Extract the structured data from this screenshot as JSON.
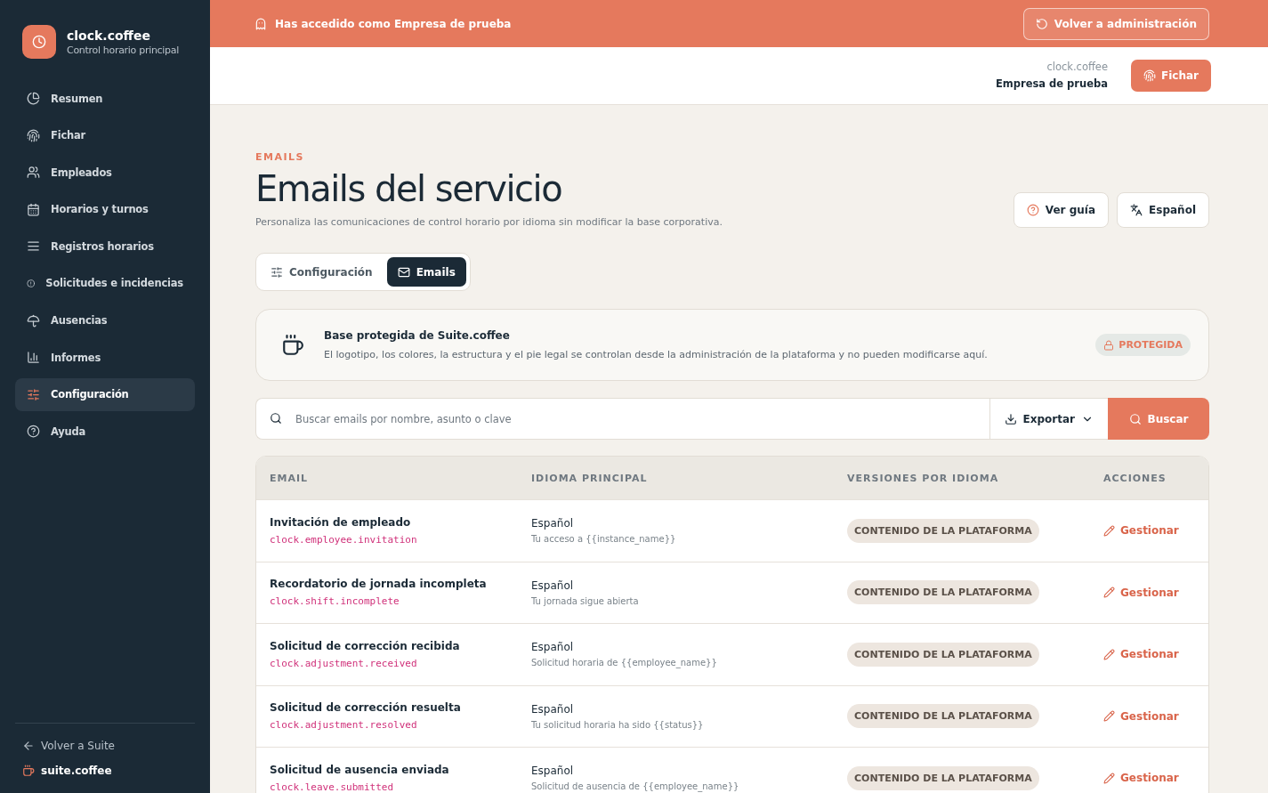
{
  "brand": {
    "name": "clock.coffee",
    "subtitle": "Control horario principal"
  },
  "nav": [
    {
      "label": "Resumen",
      "selected": false
    },
    {
      "label": "Fichar",
      "selected": false
    },
    {
      "label": "Empleados",
      "selected": false
    },
    {
      "label": "Horarios y turnos",
      "selected": false
    },
    {
      "label": "Registros horarios",
      "selected": false
    },
    {
      "label": "Solicitudes e incidencias",
      "selected": false
    },
    {
      "label": "Ausencias",
      "selected": false
    },
    {
      "label": "Informes",
      "selected": false
    },
    {
      "label": "Configuración",
      "selected": true
    },
    {
      "label": "Ayuda",
      "selected": false
    }
  ],
  "sidebar_footer": {
    "back_link": "Volver a Suite",
    "suite_name": "suite.coffee"
  },
  "impersonation_banner": {
    "text": "Has accedido como Empresa de prueba",
    "button": "Volver a administración"
  },
  "header": {
    "app": "clock.coffee",
    "company": "Empresa de prueba",
    "button": "Fichar"
  },
  "page": {
    "eyebrow": "EMAILS",
    "title": "Emails del servicio",
    "description": "Personaliza las comunicaciones de control horario por idioma sin modificar la base corporativa.",
    "actions": [
      "Ver guía",
      "Español"
    ]
  },
  "tabs": [
    {
      "label": "Configuración",
      "selected": false
    },
    {
      "label": "Emails",
      "selected": true
    }
  ],
  "notice": {
    "title": "Base protegida de Suite.coffee",
    "text": "El logotipo, los colores, la estructura y el pie legal se controlan desde la administración de la plataforma y no pueden modificarse aquí.",
    "badge": "PROTEGIDA"
  },
  "search": {
    "placeholder": "Buscar emails por nombre, asunto o clave",
    "export": "Exportar",
    "button": "Buscar"
  },
  "table": {
    "columns": [
      "EMAIL",
      "IDIOMA PRINCIPAL",
      "VERSIONES POR IDIOMA",
      "ACCIONES"
    ],
    "rows": [
      {
        "name": "Invitación de empleado",
        "key": "clock.employee.invitation",
        "language": "Español",
        "subject": "Tu acceso a {{instance_name}}",
        "versions": "CONTENIDO DE LA PLATAFORMA",
        "action": "Gestionar"
      },
      {
        "name": "Recordatorio de jornada incompleta",
        "key": "clock.shift.incomplete",
        "language": "Español",
        "subject": "Tu jornada sigue abierta",
        "versions": "CONTENIDO DE LA PLATAFORMA",
        "action": "Gestionar"
      },
      {
        "name": "Solicitud de corrección recibida",
        "key": "clock.adjustment.received",
        "language": "Español",
        "subject": "Solicitud horaria de {{employee_name}}",
        "versions": "CONTENIDO DE LA PLATAFORMA",
        "action": "Gestionar"
      },
      {
        "name": "Solicitud de corrección resuelta",
        "key": "clock.adjustment.resolved",
        "language": "Español",
        "subject": "Tu solicitud horaria ha sido {{status}}",
        "versions": "CONTENIDO DE LA PLATAFORMA",
        "action": "Gestionar"
      },
      {
        "name": "Solicitud de ausencia enviada",
        "key": "clock.leave.submitted",
        "language": "Español",
        "subject": "Solicitud de ausencia de {{employee_name}}",
        "versions": "CONTENIDO DE LA PLATAFORMA",
        "action": "Gestionar"
      }
    ]
  }
}
